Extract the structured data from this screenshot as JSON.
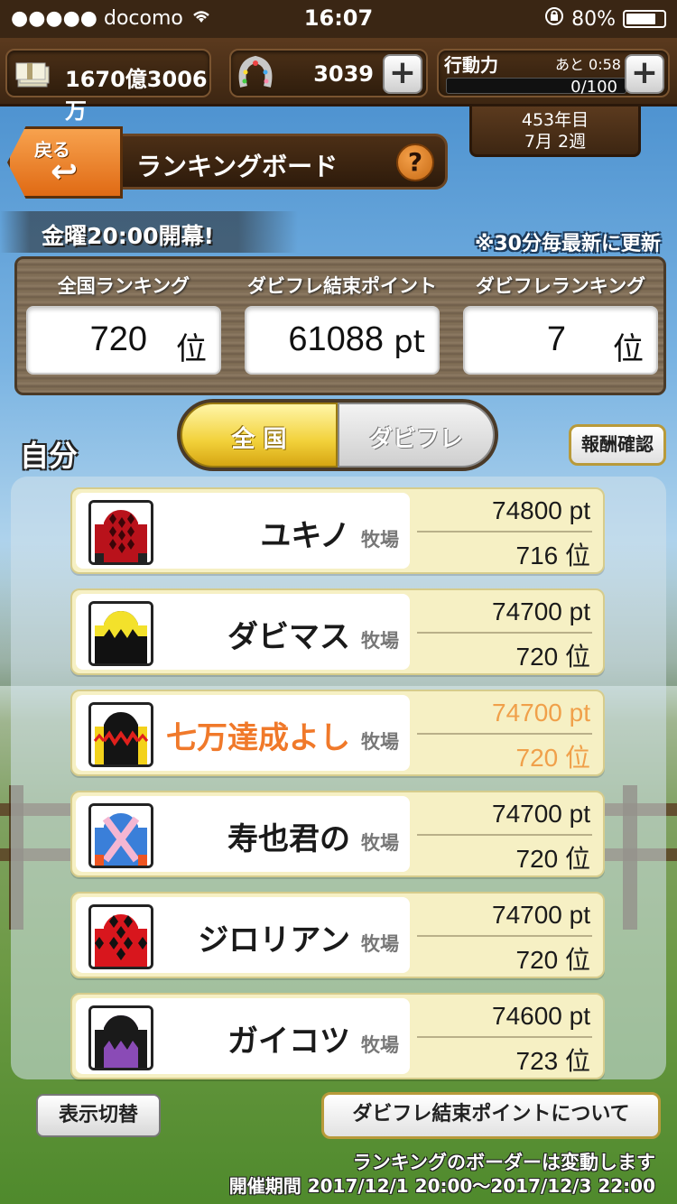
{
  "status_bar": {
    "carrier": "●●●●● docomo",
    "time": "16:07",
    "battery": "80%",
    "battery_level": 0.8
  },
  "resources": {
    "money": "1670億3006万",
    "horseshoes": "3039",
    "action_label": "行動力",
    "action_time": "あと 0:58",
    "action_value": "0/100",
    "action_level": 0.0
  },
  "date": {
    "year": "453年目",
    "week": "7月  2週"
  },
  "header": {
    "back_label": "戻る",
    "back_arrow": "↩",
    "title": "ランキングボード",
    "help": "?"
  },
  "announcement": "金曜20:00開幕!",
  "update_note": "※30分毎最新に更新",
  "stats": [
    {
      "label": "全国ランキング",
      "value": "720",
      "unit": "位"
    },
    {
      "label": "ダビフレ結束ポイント",
      "value": "61088",
      "unit": "pt"
    },
    {
      "label": "ダビフレランキング",
      "value": "7",
      "unit": "位"
    }
  ],
  "tabs": {
    "national": "全 国",
    "friends": "ダビフレ"
  },
  "self_label": "自分",
  "reward_button": "報酬確認",
  "farm_suffix": "牧場",
  "rows": [
    {
      "name": "ユキノ",
      "points": "74800 pt",
      "rank": "716 位",
      "silks": "red-diamonds",
      "me": false
    },
    {
      "name": "ダビマス",
      "points": "74700 pt",
      "rank": "720 位",
      "silks": "yellow-zigzag",
      "me": false
    },
    {
      "name": "七万達成よし",
      "points": "74700 pt",
      "rank": "720 位",
      "silks": "black-red-zigzag",
      "me": true
    },
    {
      "name": "寿也君の",
      "points": "74700 pt",
      "rank": "720 位",
      "silks": "blue-pink-cross",
      "me": false
    },
    {
      "name": "ジロリアン",
      "points": "74700 pt",
      "rank": "720 位",
      "silks": "red-black-check",
      "me": false
    },
    {
      "name": "ガイコツ",
      "points": "74600 pt",
      "rank": "723 位",
      "silks": "black-purple",
      "me": false
    }
  ],
  "buttons": {
    "switch_display": "表示切替",
    "about_points": "ダビフレ結束ポイントについて"
  },
  "footer": {
    "line1": "ランキングのボーダーは変動します",
    "line2": "開催期間  2017/12/1  20:00〜2017/12/3  22:00"
  },
  "colors": {
    "me_name": "#f0792a",
    "me_points": "#f0a04a",
    "tab_active": "#f2d13a",
    "row_bg": "#f6f0c4"
  }
}
